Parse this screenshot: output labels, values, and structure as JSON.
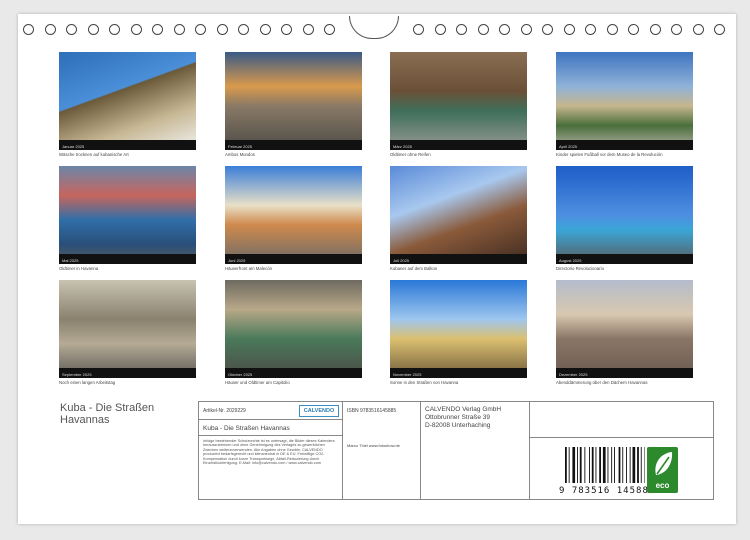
{
  "colors": {
    "sheet": "#ffffff",
    "frame": "#888888",
    "eco_green": "#2c8a2c",
    "brand_blue": "#3a8fc4"
  },
  "months": [
    {
      "label": "Januar 2025",
      "caption": "Wäsche trocknen auf kubanische Art"
    },
    {
      "label": "Februar 2025",
      "caption": "Ambos Mundos"
    },
    {
      "label": "März 2025",
      "caption": "Oldtimer ohne Reifen"
    },
    {
      "label": "April 2025",
      "caption": "Kinder spielen Fußball vor dem Museo de la Revolución"
    },
    {
      "label": "Mai 2025",
      "caption": "Oldtimer in Havanna"
    },
    {
      "label": "Juni 2025",
      "caption": "Häuserfront am Malecón"
    },
    {
      "label": "Juli 2025",
      "caption": "Kubaner auf dem Balkon"
    },
    {
      "label": "August 2025",
      "caption": "Directorio Revolucionario"
    },
    {
      "label": "September 2025",
      "caption": "Noch einen langen Arbeitstag"
    },
    {
      "label": "Oktober 2025",
      "caption": "Häuser und Oldtimer am Capitolio"
    },
    {
      "label": "November 2025",
      "caption": "Sonne in den Straßen von Havanna"
    },
    {
      "label": "Dezember 2025",
      "caption": "Abenddämmerung über den Dächern Havannas"
    }
  ],
  "calendar_title": "Kuba - Die Straßen Havannas",
  "info": {
    "article": "Artikel-Nr. 2029229",
    "logo": "CALVENDO",
    "isbn": "ISBN 9783516145885",
    "title_line": "Kuba - Die Straßen Havannas",
    "copyright": "Marco Thiel www.fotoshow.de",
    "publisher": [
      "CALVENDO Verlag GmbH",
      "Ottobrunner Straße 39",
      "D-82008 Unterhaching"
    ],
    "legal": "Infolge bestehender Schutzrechte ist es untersagt, die Bilder dieses Kalenders herauszutrennen und ohne Genehmigung des Verlages zu gewerblichen Zwecken weiterzuverwenden. Alle Angaben ohne Gewähr. CALVENDO produziert bedarfsgerecht und klimaneutral in DE & EU. Freiwillige CO2-Kompensation durch kurze Transportwege, Abfall-Reduzierung durch Einzelstückfertigung. E-Mail: info@calvendo.com / www.calvendo.com",
    "barcode_digits": "9 783516 145885",
    "eco_label": "eco"
  }
}
